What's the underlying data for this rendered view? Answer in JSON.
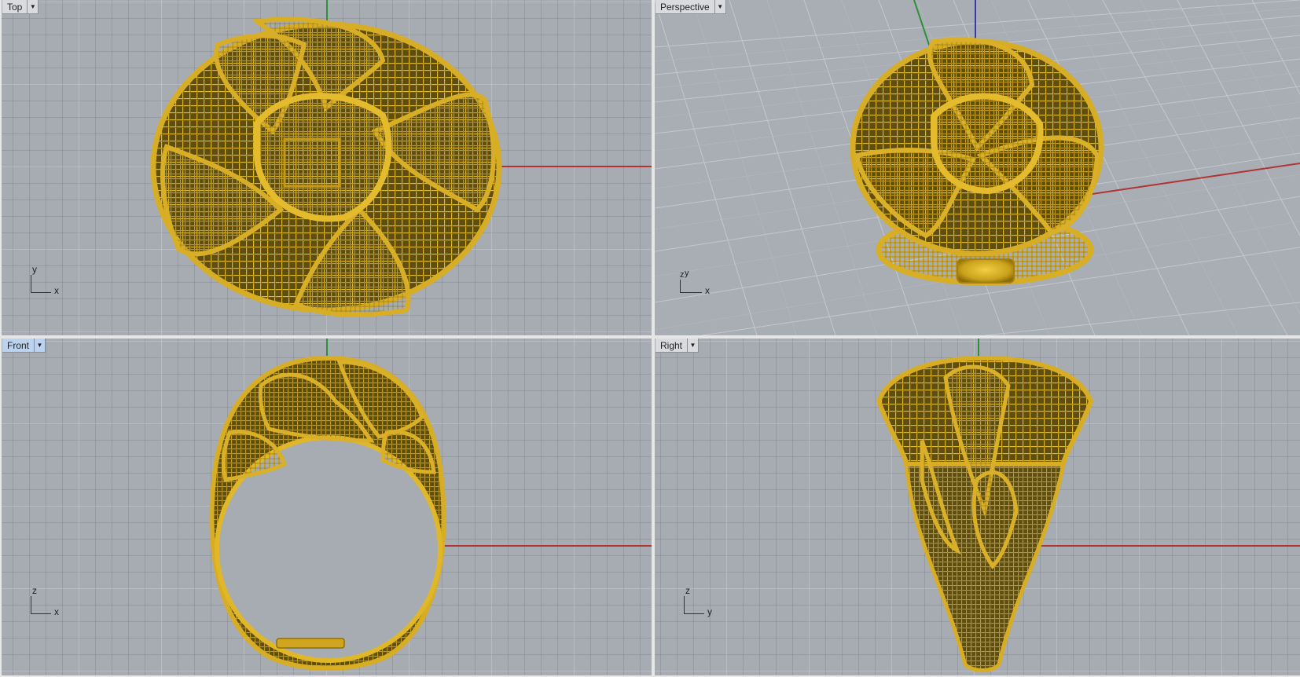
{
  "viewports": {
    "top": {
      "label": "Top",
      "axis_labels": [
        "y",
        "x"
      ]
    },
    "persp": {
      "label": "Perspective",
      "axis_labels": [
        "z",
        "y",
        "x"
      ]
    },
    "front": {
      "label": "Front",
      "axis_labels": [
        "z",
        "x"
      ]
    },
    "right": {
      "label": "Right",
      "axis_labels": [
        "z",
        "y"
      ]
    }
  },
  "active_viewport": "Front",
  "colors": {
    "viewport_bg": "#a7acb2",
    "gold": "#c9a21a",
    "axis_x": "#b03434",
    "axis_y": "#2f8f3a",
    "axis_z": "#3a3aa8"
  },
  "icons": {
    "dropdown": "chevron-down-icon",
    "model": "ring-model"
  }
}
